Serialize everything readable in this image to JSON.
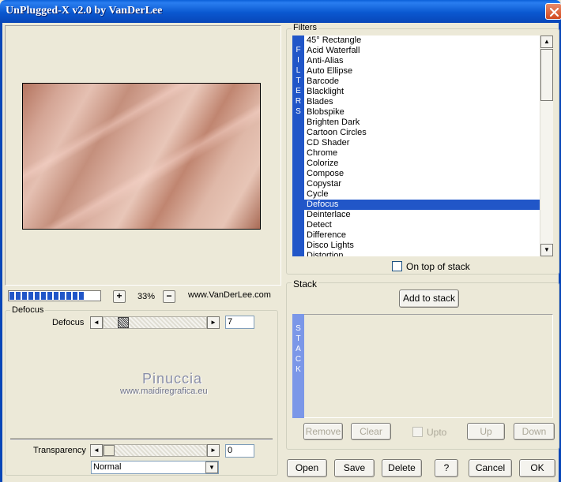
{
  "window": {
    "title": "UnPlugged-X v2.0 by VanDerLee",
    "close_glyph": "✕"
  },
  "preview": {
    "zoom": "33%",
    "zoom_in": "+",
    "zoom_out": "−",
    "website": "www.VanDerLee.com",
    "progress_segments": 12
  },
  "defocus": {
    "group_label": "Defocus",
    "param_label": "Defocus",
    "value": "7",
    "left_arrow": "◄",
    "right_arrow": "►"
  },
  "watermark": {
    "name": "Pinuccia",
    "url": "www.maidiregrafica.eu"
  },
  "transparency": {
    "label": "Transparency",
    "value": "0",
    "blend_mode": "Normal",
    "left_arrow": "◄",
    "right_arrow": "►",
    "dropdown_glyph": "▼"
  },
  "filters": {
    "group_label": "Filters",
    "banner": [
      "F",
      "I",
      "L",
      "T",
      "E",
      "R",
      "S"
    ],
    "items": [
      "45° Rectangle",
      "Acid Waterfall",
      "Anti-Alias",
      "Auto Ellipse",
      "Barcode",
      "Blacklight",
      "Blades",
      "Blobspike",
      "Brighten Dark",
      "Cartoon Circles",
      "CD Shader",
      "Chrome",
      "Colorize",
      "Compose",
      "Copystar",
      "Cycle",
      "Defocus",
      "Deinterlace",
      "Detect",
      "Difference",
      "Disco Lights",
      "Distortion"
    ],
    "selected": "Defocus",
    "on_top_label": "On top of stack",
    "scroll_up": "▲",
    "scroll_down": "▼"
  },
  "stack": {
    "group_label": "Stack",
    "add_button": "Add to stack",
    "banner": [
      "S",
      "T",
      "A",
      "C",
      "K"
    ],
    "remove": "Remove",
    "clear": "Clear",
    "upto": "Upto",
    "up": "Up",
    "down": "Down"
  },
  "bottom_buttons": {
    "open": "Open",
    "save": "Save",
    "delete": "Delete",
    "help": "?",
    "cancel": "Cancel",
    "ok": "OK"
  },
  "colors": {
    "title_bar": "#0a58d0",
    "selection": "#2156c8",
    "stack_banner": "#7b97e8",
    "face": "#ece9d8"
  }
}
